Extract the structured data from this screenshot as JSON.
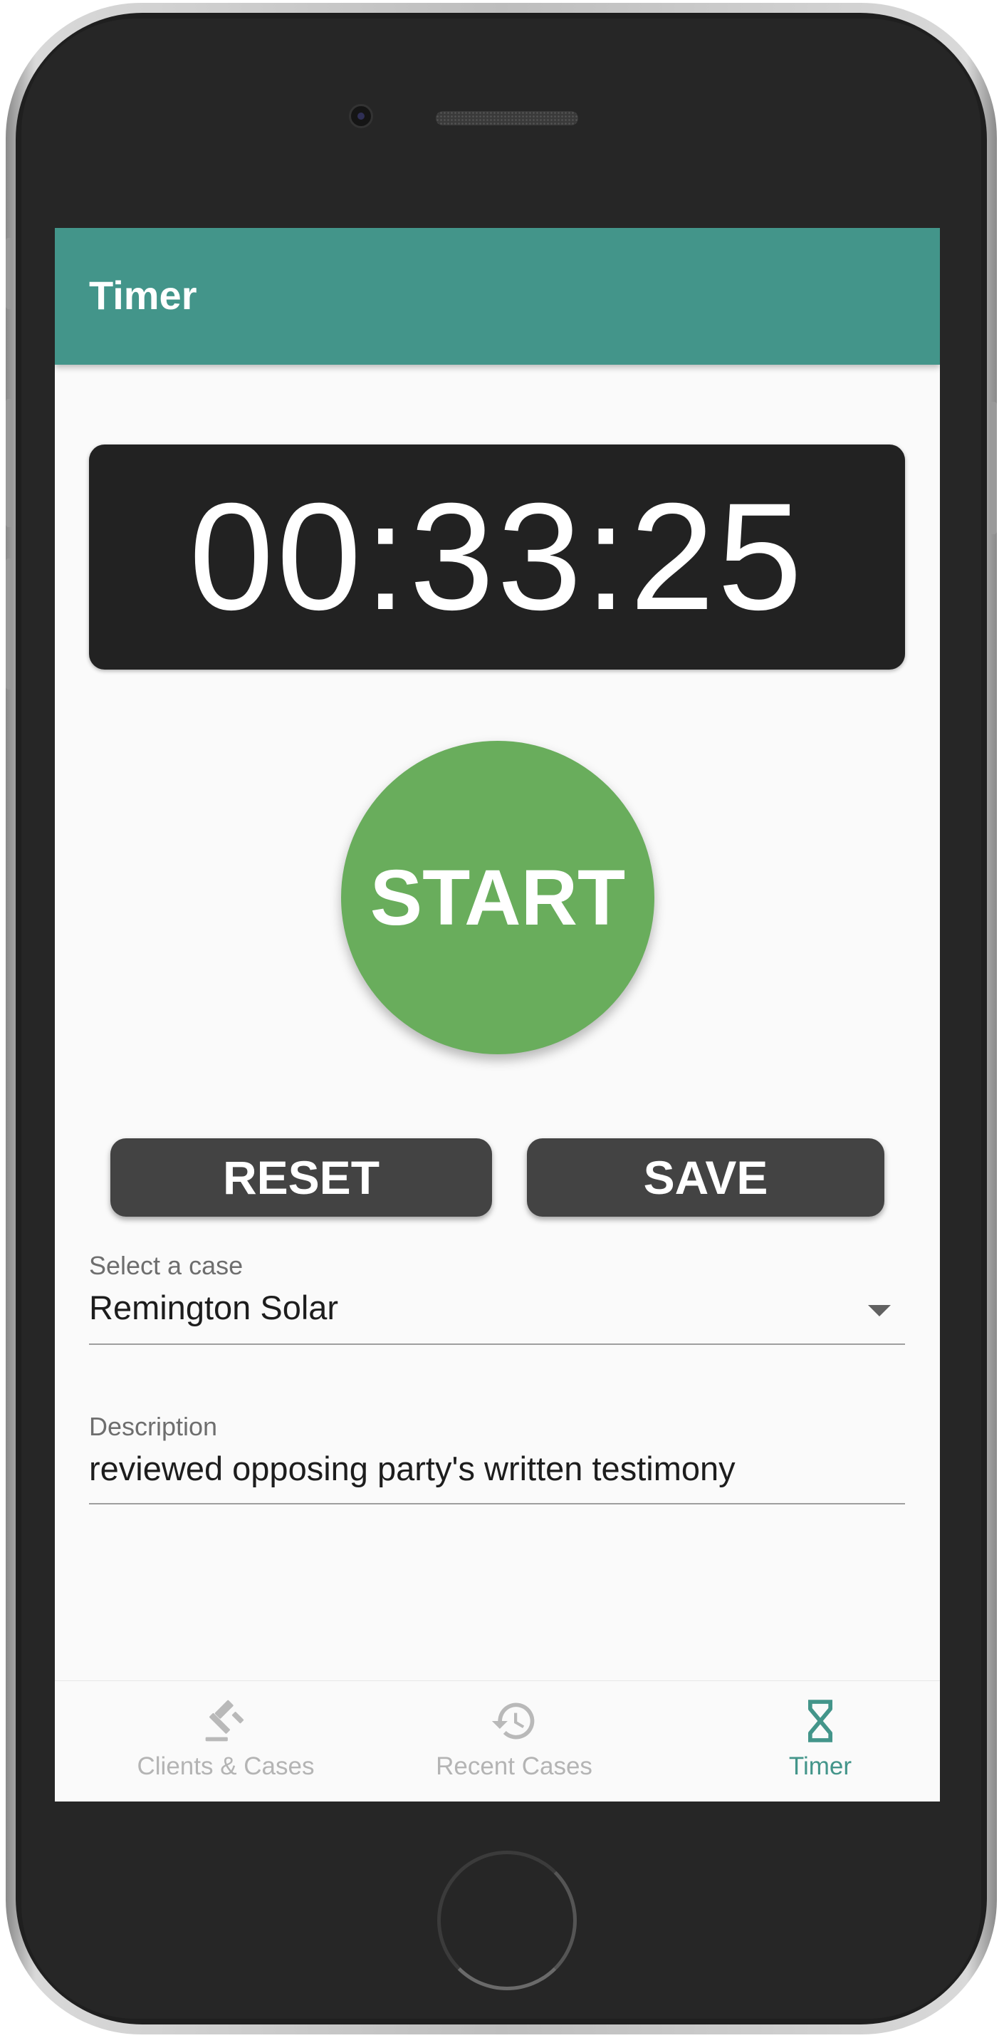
{
  "app_bar": {
    "title": "Timer"
  },
  "timer": {
    "display": "00:33:25"
  },
  "controls": {
    "start_label": "START",
    "reset_label": "RESET",
    "save_label": "SAVE"
  },
  "case_select": {
    "label": "Select a case",
    "selected": "Remington Solar"
  },
  "description": {
    "label": "Description",
    "value": "reviewed opposing party's written testimony"
  },
  "bottom_nav": {
    "items": [
      {
        "label": "Clients & Cases",
        "icon": "gavel-icon",
        "active": false
      },
      {
        "label": "Recent Cases",
        "icon": "history-icon",
        "active": false
      },
      {
        "label": "Timer",
        "icon": "hourglass-icon",
        "active": true
      }
    ]
  },
  "colors": {
    "primary": "#43958a",
    "start": "#69ad5c",
    "button_dark": "#434343",
    "display_bg": "#222222"
  }
}
